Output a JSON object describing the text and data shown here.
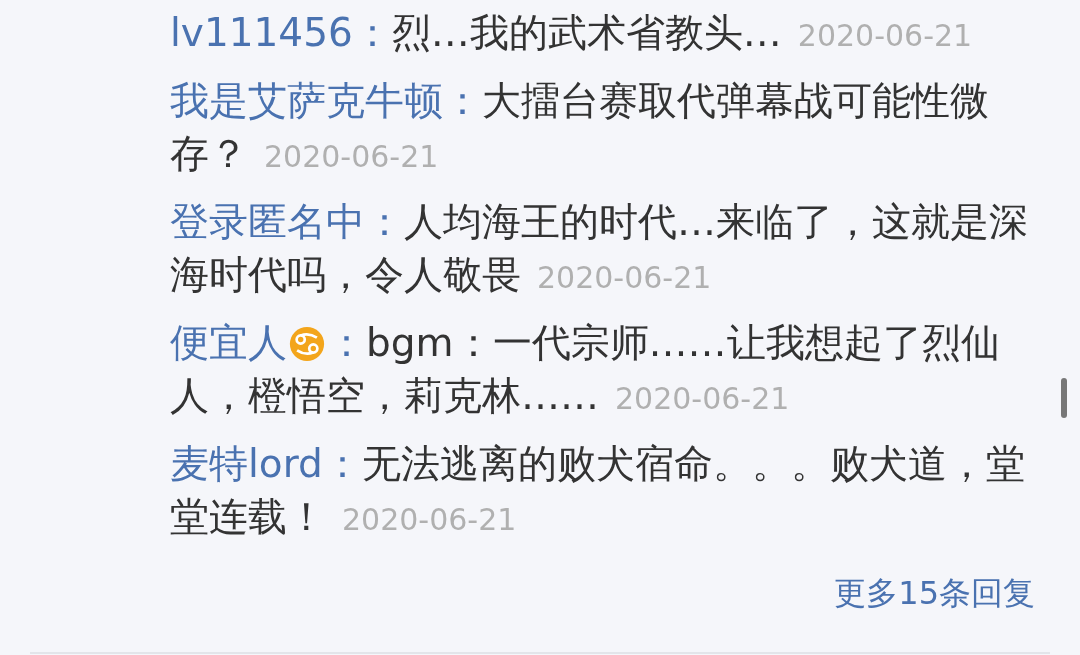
{
  "replies": [
    {
      "name": "lv111456",
      "badge": false,
      "separator": "：",
      "text": "烈…我的武术省教头…",
      "date": "2020-06-21"
    },
    {
      "name": "我是艾萨克牛顿",
      "badge": false,
      "separator": "：",
      "text": "大擂台赛取代弹幕战可能性微存？",
      "date": "2020-06-21"
    },
    {
      "name": "登录匿名中",
      "badge": false,
      "separator": "：",
      "text": "人均海王的时代…来临了，这就是深海时代吗，令人敬畏",
      "date": "2020-06-21"
    },
    {
      "name": "便宜人",
      "badge": true,
      "separator": "：",
      "text": "bgm：一代宗师……让我想起了烈仙人，橙悟空，莉克林……",
      "date": "2020-06-21"
    },
    {
      "name": "麦特lord",
      "badge": false,
      "separator": "：",
      "text": "无法逃离的败犬宿命。。。败犬道，堂堂连载！",
      "date": "2020-06-21"
    }
  ],
  "more_link": "更多15条回复"
}
